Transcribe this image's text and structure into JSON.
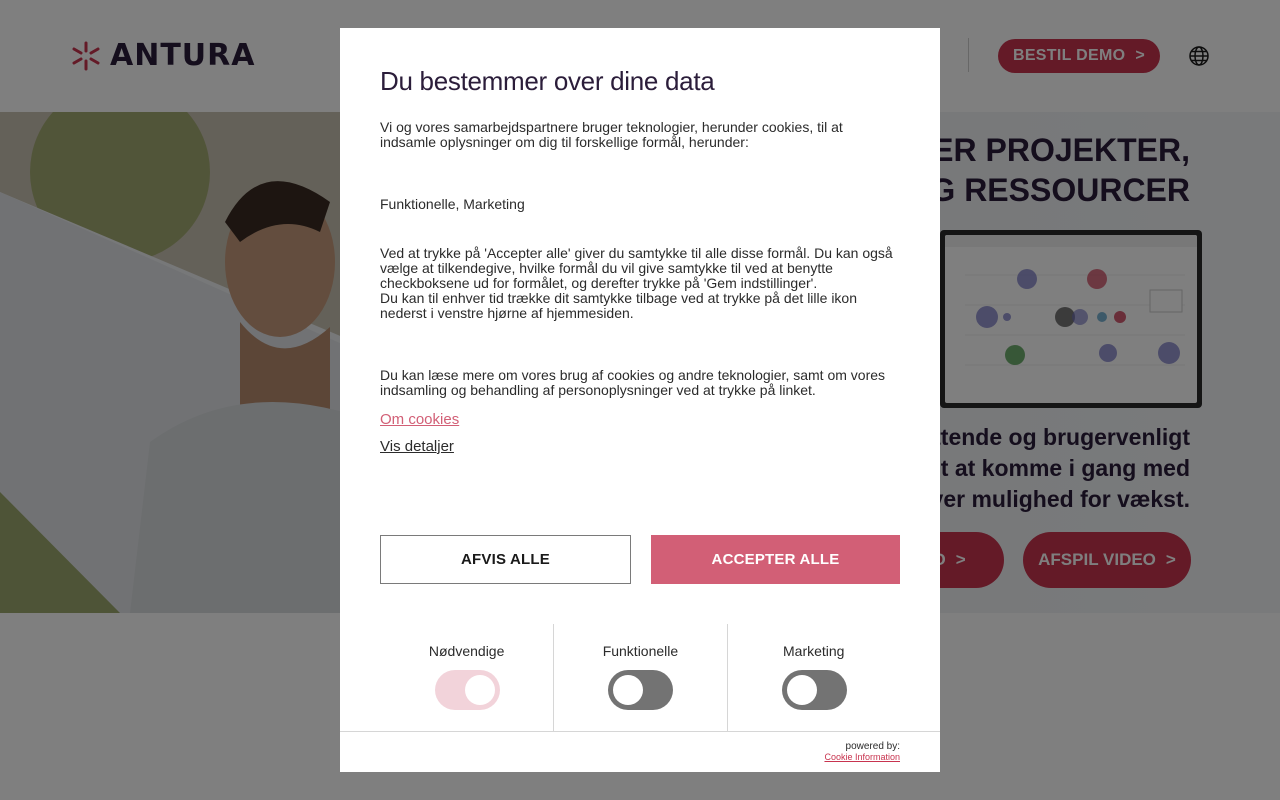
{
  "site": {
    "logo_text": "ANTURA",
    "nav": {
      "demo_label": "BESTIL DEMO",
      "demo_chevron": ">"
    },
    "hero": {
      "title_line1": "OVER PROJEKTER,",
      "title_line2": "ER OG RESSOURCER",
      "text_line1": "attende og brugervenligt",
      "text_line2": "emt at komme i gang med",
      "text_line3": "giver mulighed for vækst.",
      "btn1_label": "MO",
      "btn2_label": "AFSPIL VIDEO",
      "chevron": ">"
    }
  },
  "consent": {
    "title": "Du bestemmer over dine data",
    "intro": "Vi og vores samarbejdspartnere bruger teknologier, herunder cookies, til at indsamle oplysninger om dig til forskellige formål, herunder:",
    "purposes": "Funktionelle, Marketing",
    "explanation_1": "Ved at trykke på 'Accepter alle' giver du samtykke til alle disse formål. Du kan også vælge at tilkendegive, hvilke formål du vil give samtykke til ved at benytte checkboksene ud for formålet, og derefter trykke på 'Gem indstillinger'.",
    "explanation_2": "Du kan til enhver tid trække dit samtykke tilbage ved at trykke på det lille ikon nederst i venstre hjørne af hjemmesiden.",
    "read_more": "Du kan læse mere om vores brug af cookies og andre teknologier, samt om vores indsamling og behandling af personoplysninger ved at trykke på linket.",
    "link_cookies": "Om cookies",
    "link_details": "Vis detaljer",
    "btn_reject": "AFVIS ALLE",
    "btn_accept": "ACCEPTER ALLE",
    "toggles": [
      {
        "label": "Nødvendige",
        "on": true
      },
      {
        "label": "Funktionelle",
        "on": false
      },
      {
        "label": "Marketing",
        "on": false
      }
    ],
    "footer": {
      "powered_by": "powered by:",
      "provider": "Cookie Information"
    }
  },
  "colors": {
    "brand": "#c8344f",
    "accent_pink": "#d25f76",
    "dark": "#2b1d3a"
  }
}
